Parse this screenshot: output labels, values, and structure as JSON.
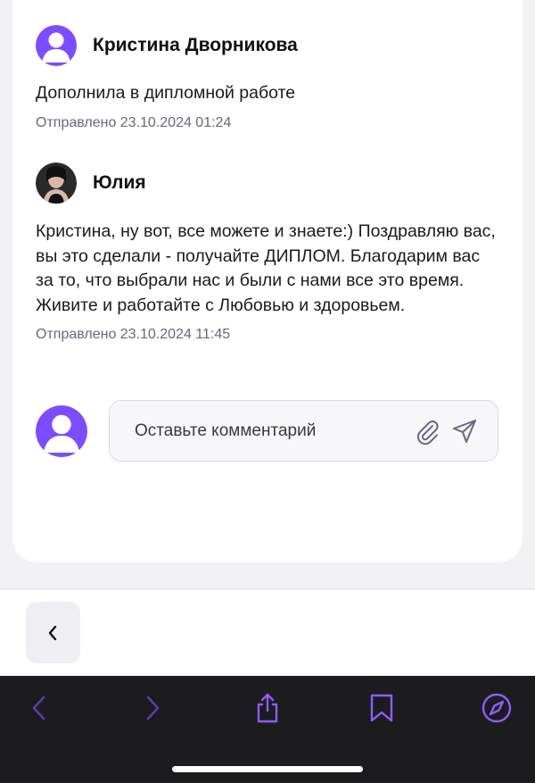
{
  "comments": [
    {
      "author": "Кристина Дворникова",
      "avatar_icon": "default-user-avatar",
      "text": "Дополнила в дипломной работе",
      "time": "Отправлено 23.10.2024 01:24"
    },
    {
      "author": "Юлия",
      "avatar_icon": "user-photo-avatar",
      "text": "Кристина, ну вот, все можете и знаете:) Поздравляю вас, вы это сделали - получайте ДИПЛОМ. Благодарим вас за то, что выбрали нас и были с нами все это время. Живите и работайте с Любовью и здоровьем.",
      "time": "Отправлено 23.10.2024 11:45"
    }
  ],
  "composer": {
    "placeholder": "Оставьте комментарий",
    "attach_icon": "paperclip-icon",
    "send_icon": "send-icon"
  },
  "nav": {
    "back_icon": "chevron-left-icon"
  },
  "browser_toolbar": {
    "icons": [
      "back-arrow-icon",
      "forward-arrow-icon",
      "share-icon",
      "bookmark-icon",
      "compass-icon"
    ]
  },
  "colors": {
    "accent": "#7c4dff",
    "accent_dim": "#5b3ba8",
    "timestamp": "#6a6582",
    "toolbar_bg": "#1c1c1e"
  }
}
